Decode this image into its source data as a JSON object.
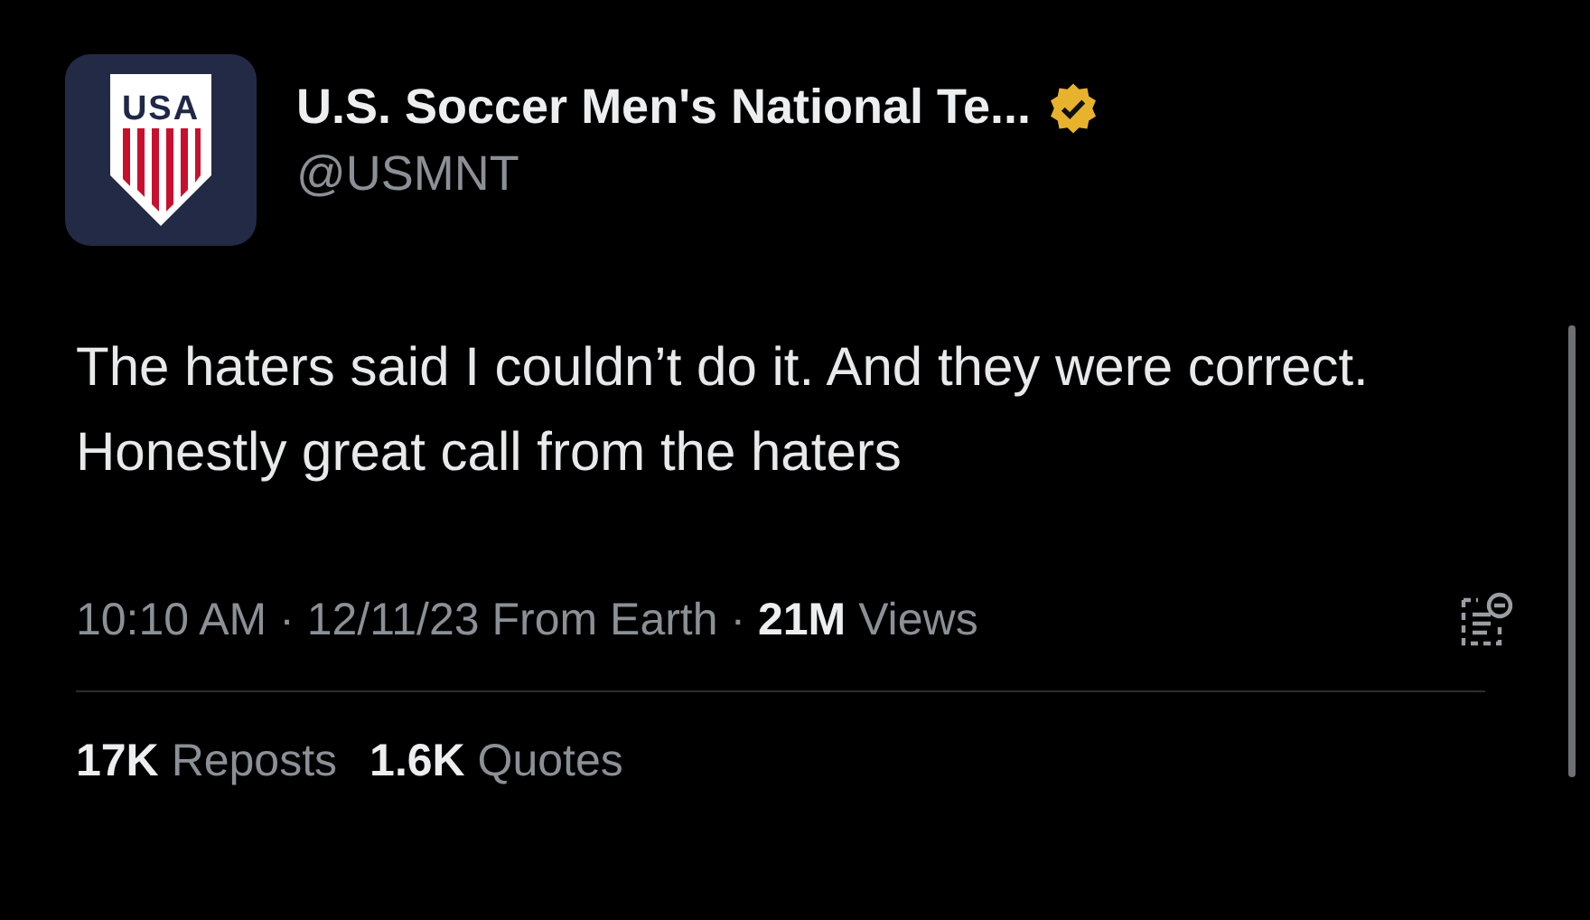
{
  "author": {
    "logo_text": "USA",
    "name": "U.S. Soccer Men's National Te...",
    "verified": true,
    "handle": "@USMNT"
  },
  "tweet": {
    "text": "The haters said I couldn’t do it. And they were correct. Honestly great call from the haters",
    "meta": "10:10 AM · 12/11/23 From Earth · **21M** Views"
  },
  "stats": [
    {
      "count": "17K",
      "label": "Reposts"
    },
    {
      "count": "1.6K",
      "label": "Quotes"
    }
  ]
}
